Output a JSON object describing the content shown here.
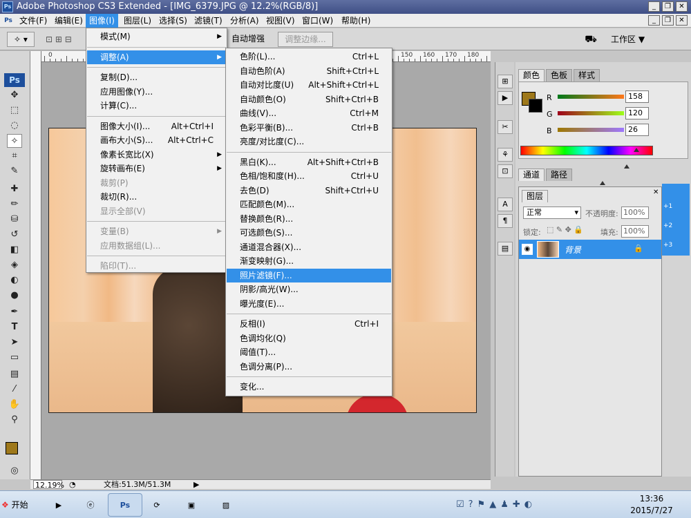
{
  "window": {
    "title": "Adobe Photoshop CS3 Extended - [IMG_6379.JPG @ 12.2%(RGB/8)]",
    "app_badge": "Ps",
    "outer_controls": [
      "_",
      "❐",
      "✕"
    ],
    "doc_controls": [
      "_",
      "❐",
      "✕"
    ]
  },
  "menubar": {
    "items": [
      "文件(F)",
      "编辑(E)",
      "图像(I)",
      "图层(L)",
      "选择(S)",
      "滤镜(T)",
      "分析(A)",
      "视图(V)",
      "窗口(W)",
      "帮助(H)"
    ],
    "active_index": 2
  },
  "options_bar": {
    "auto_enhance": "自动增强",
    "refine_edge": "调整边缘...",
    "workspace": "工作区 ▼"
  },
  "ruler": {
    "top_ticks": [
      "0",
      "150",
      "160",
      "170",
      "180"
    ]
  },
  "image_menu": {
    "items": [
      {
        "label": "模式(M)",
        "submenu": true
      },
      {
        "sep": true
      },
      {
        "label": "调整(A)",
        "submenu": true,
        "highlight": true
      },
      {
        "sep": true
      },
      {
        "label": "复制(D)..."
      },
      {
        "label": "应用图像(Y)..."
      },
      {
        "label": "计算(C)..."
      },
      {
        "sep": true
      },
      {
        "label": "图像大小(I)...",
        "shortcut": "Alt+Ctrl+I"
      },
      {
        "label": "画布大小(S)...",
        "shortcut": "Alt+Ctrl+C"
      },
      {
        "label": "像素长宽比(X)",
        "submenu": true
      },
      {
        "label": "旋转画布(E)",
        "submenu": true
      },
      {
        "label": "裁剪(P)",
        "disabled": true
      },
      {
        "label": "裁切(R)..."
      },
      {
        "label": "显示全部(V)",
        "disabled": true
      },
      {
        "sep": true
      },
      {
        "label": "变量(B)",
        "submenu": true,
        "disabled": true
      },
      {
        "label": "应用数据组(L)...",
        "disabled": true
      },
      {
        "sep": true
      },
      {
        "label": "陷印(T)...",
        "disabled": true
      }
    ]
  },
  "adjust_menu": {
    "items": [
      {
        "label": "色阶(L)...",
        "shortcut": "Ctrl+L"
      },
      {
        "label": "自动色阶(A)",
        "shortcut": "Shift+Ctrl+L"
      },
      {
        "label": "自动对比度(U)",
        "shortcut": "Alt+Shift+Ctrl+L"
      },
      {
        "label": "自动颜色(O)",
        "shortcut": "Shift+Ctrl+B"
      },
      {
        "label": "曲线(V)...",
        "shortcut": "Ctrl+M"
      },
      {
        "label": "色彩平衡(B)...",
        "shortcut": "Ctrl+B"
      },
      {
        "label": "亮度/对比度(C)..."
      },
      {
        "sep": true
      },
      {
        "label": "黑白(K)...",
        "shortcut": "Alt+Shift+Ctrl+B"
      },
      {
        "label": "色相/饱和度(H)...",
        "shortcut": "Ctrl+U"
      },
      {
        "label": "去色(D)",
        "shortcut": "Shift+Ctrl+U"
      },
      {
        "label": "匹配颜色(M)..."
      },
      {
        "label": "替换颜色(R)..."
      },
      {
        "label": "可选颜色(S)..."
      },
      {
        "label": "通道混合器(X)..."
      },
      {
        "label": "渐变映射(G)..."
      },
      {
        "label": "照片滤镜(F)...",
        "highlight": true
      },
      {
        "label": "阴影/高光(W)..."
      },
      {
        "label": "曝光度(E)..."
      },
      {
        "sep": true
      },
      {
        "label": "反相(I)",
        "shortcut": "Ctrl+I"
      },
      {
        "label": "色调均化(Q)"
      },
      {
        "label": "阈值(T)..."
      },
      {
        "label": "色调分离(P)..."
      },
      {
        "sep": true
      },
      {
        "label": "变化..."
      }
    ]
  },
  "color_panel": {
    "tabs": [
      "颜色",
      "色板",
      "样式"
    ],
    "channels": [
      {
        "label": "R",
        "value": "158"
      },
      {
        "label": "G",
        "value": "120"
      },
      {
        "label": "B",
        "value": "26"
      }
    ],
    "fg_color": "#9e781a"
  },
  "channels_panel": {
    "tabs": [
      "通道",
      "路径"
    ]
  },
  "layers_panel": {
    "tab": "图层",
    "blend_mode": "正常",
    "opacity_label": "不透明度:",
    "opacity_value": "100%",
    "lock_label": "锁定:",
    "fill_label": "填充:",
    "fill_value": "100%",
    "layer_name": "背景",
    "side_labels": [
      "+1",
      "+2",
      "+3"
    ]
  },
  "status": {
    "zoom": "12.19%",
    "doc_info": "文档:51.3M/51.3M"
  },
  "taskbar": {
    "start_label": "开始",
    "time": "13:36",
    "date": "2015/7/27"
  },
  "colors": {
    "accent": "#3390e8",
    "title": "#3f4f86"
  }
}
